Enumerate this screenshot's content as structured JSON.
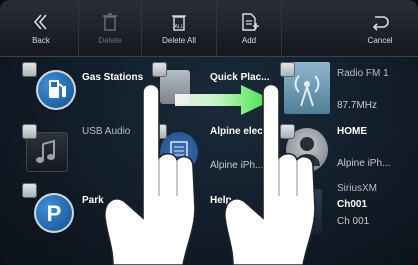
{
  "toolbar": {
    "back_label": "Back",
    "delete_label": "Delete",
    "delete_all_label": "Delete All",
    "add_label": "Add",
    "cancel_label": "Cancel"
  },
  "tiles": [
    {
      "label": "Gas Stations"
    },
    {
      "label": "Quick Plac..."
    },
    {
      "label": "Radio FM 1",
      "sub": "87.7MHz"
    },
    {
      "label": "USB Audio"
    },
    {
      "label": "Alpine elec...",
      "sub": "Alpine iPh..."
    },
    {
      "label": "HOME",
      "sub": "Alpine iPh..."
    },
    {
      "label": "Park"
    },
    {
      "label": "Help"
    },
    {
      "label": "SiriusXM",
      "sub": "Ch001",
      "sub2": "Ch 001"
    }
  ],
  "colors": {
    "accent_green": "#39e03f",
    "poi_blue": "#1e6fb8"
  }
}
